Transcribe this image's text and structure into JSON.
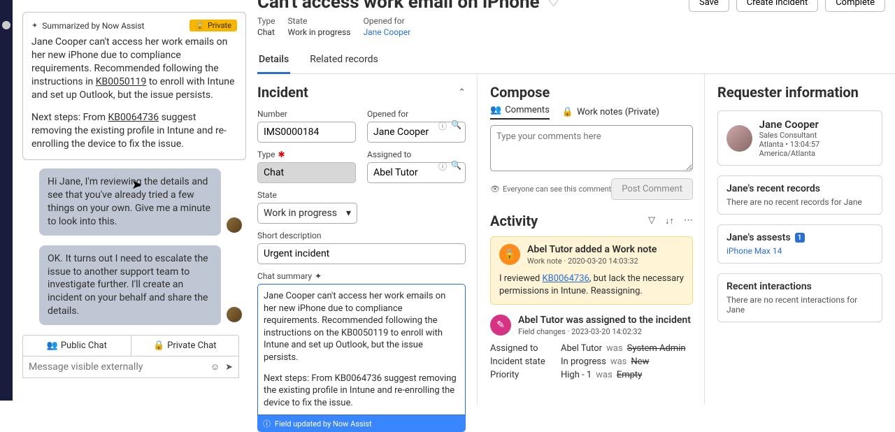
{
  "header": {
    "title": "Can't access work email on iPhone",
    "actions": {
      "save": "Save",
      "create": "Create Incident",
      "complete": "Complete"
    },
    "meta": {
      "type_label": "Type",
      "type_val": "Chat",
      "state_label": "State",
      "state_val": "Work in progress",
      "opened_for_label": "Opened for",
      "opened_for_val": "Jane Cooper"
    },
    "tabs": {
      "details": "Details",
      "related": "Related records"
    }
  },
  "chat": {
    "summary_by": "Summarized by Now Assist",
    "private_badge": "Private",
    "summary_p1_a": "Jane Cooper can't access her work emails on her new iPhone due to compliance requirements. Recommended following the instructions in ",
    "summary_kb1": "KB0050119",
    "summary_p1_b": " to enroll with Intune and set up Outlook, but the issue persists.",
    "summary_p2_a": "Next steps: From ",
    "summary_kb2": "KB0064736",
    "summary_p2_b": " suggest removing the existing profile in Intune and re-enrolling the device to fix the issue.",
    "msg1": "Hi Jane, I'm reviewing the details and see that you've already tried a few things on your own. Give me a minute to look into this.",
    "msg2": "OK. It turns out I need to escalate the issue to another support team to investigate further. I'll create an incident on your behalf and share the details.",
    "public_tab": "Public Chat",
    "private_tab": "Private Chat",
    "input_placeholder": "Message visible externally"
  },
  "incident": {
    "section": "Incident",
    "number_label": "Number",
    "number": "IMS0000184",
    "opened_for_label": "Opened for",
    "opened_for": "Jane Cooper",
    "type_label": "Type",
    "type": "Chat",
    "assigned_label": "Assigned to",
    "assigned": "Abel Tutor",
    "state_label": "State",
    "state": "Work in progress",
    "short_desc_label": "Short description",
    "short_desc": "Urgent incident",
    "chat_summary_label": "Chat summary",
    "cs_p1": "Jane Cooper can't access her work emails on her new iPhone due to compliance requirements. Recommended following the instructions on the KB0050119 to enroll with Intune and set up Outlook, but the issue persists.",
    "cs_p2": "Next steps: From KB0064736 suggest removing the existing profile in Intune and re-enrolling the device to fix the issue.",
    "field_updated": "Field updated by Now Assist"
  },
  "compose": {
    "section": "Compose",
    "comments_tab": "Comments",
    "worknotes_tab": "Work notes (Private)",
    "placeholder": "Type your comments here",
    "visibility": "Everyone can see this comment",
    "post": "Post Comment"
  },
  "activity": {
    "section": "Activity",
    "wn_title": "Abel Tutor added a Work note",
    "wn_meta": "Work note  ·  2020-03-20 14:03:32",
    "wn_body_a": "I reviewed ",
    "wn_kb": "KB0064736",
    "wn_body_b": ", but lack the necessary permissions in Intune. Reassigning.",
    "as_title": "Abel Tutor was assigned to the incident",
    "as_meta": "Field changes  ·  2023-03-20 14:02:32",
    "as_rows": {
      "assigned": {
        "label": "Assigned to",
        "new": "Abel Tutor",
        "was": "was",
        "old": "System Admin"
      },
      "state": {
        "label": "Incident state",
        "new": "In progress",
        "was": "was",
        "old": "New"
      },
      "priority": {
        "label": "Priority",
        "new": "High - 1",
        "was": "was",
        "old": "Empty"
      }
    }
  },
  "requester": {
    "section": "Requester information",
    "name": "Jane Cooper",
    "role": "Sales Consultant",
    "loc": "Atlanta • 13:04:57 America/Atlanta",
    "recent_title": "Jane's recent records",
    "recent_empty": "There are no recent records for Jane",
    "assets_title": "Jane's assests",
    "assets_count": "1",
    "asset_item": "iPhone Max 14",
    "interactions_title": "Recent interactions",
    "interactions_empty": "There are no recent interactions for Jane"
  }
}
